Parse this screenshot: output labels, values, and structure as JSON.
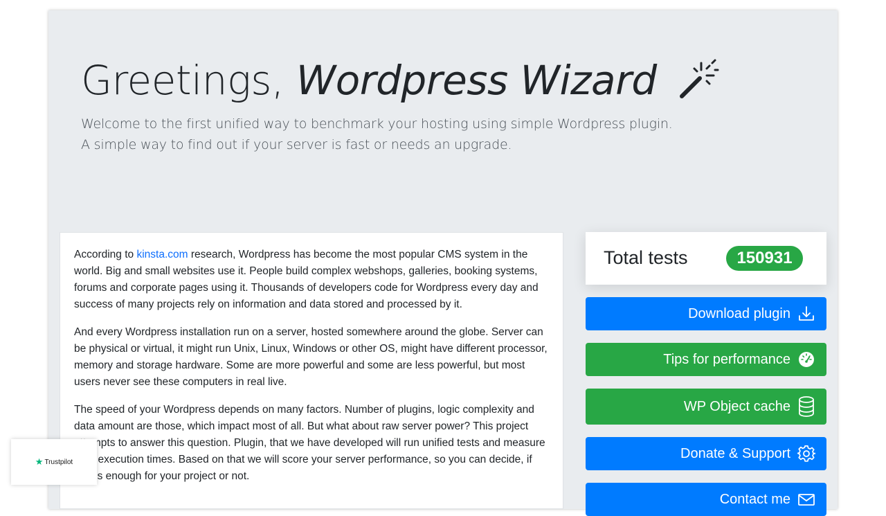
{
  "hero": {
    "title_plain": "Greetings, ",
    "title_italic": "Wordpress Wizard",
    "icon": "magic-wand-icon",
    "lead_line1": "Welcome to the first unified way to benchmark your hosting using simple Wordpress plugin.",
    "lead_line2": "A simple way to find out if your server is fast or needs an upgrade."
  },
  "content": {
    "p1_before_link": "According to ",
    "p1_link": "kinsta.com",
    "p1_after_link": " research, Wordpress has become the most popular CMS system in the world. Big and small websites use it. People build complex webshops, galleries, booking systems, forums and corporate pages using it. Thousands of developers code for Wordpress every day and success of many projects rely on information and data stored and processed by it.",
    "p2": "And every Wordpress installation run on a server, hosted somewhere around the globe. Server can be physical or virtual, it might run Unix, Linux, Windows or other OS, might have different processor, memory and storage hardware. Some are more powerful and some are less powerful, but most users never see these computers in real live.",
    "p3": "The speed of your Wordpress depends on many factors. Number of plugins, logic complexity and data amount are those, which impact most of all. But what about raw server power? This project attempts to answer this question. Plugin, that we have developed will run unified tests and measure their execution times. Based on that we will score your server performance, so you can decide, if that is enough for your project or not."
  },
  "stats": {
    "label": "Total tests",
    "count": "150931"
  },
  "sidebar_buttons": [
    {
      "label": "Download plugin",
      "icon": "download-icon",
      "color": "#007bff"
    },
    {
      "label": "Tips for performance",
      "icon": "speedometer-icon",
      "color": "#28a745"
    },
    {
      "label": "WP Object cache",
      "icon": "database-icon",
      "color": "#28a745"
    },
    {
      "label": "Donate & Support",
      "icon": "gear-icon",
      "color": "#007bff"
    },
    {
      "label": "Contact me",
      "icon": "envelope-icon",
      "color": "#007bff"
    }
  ],
  "trustpilot": {
    "label": "Trustpilot",
    "icon": "star-icon"
  },
  "colors": {
    "primary": "#007bff",
    "success": "#28a745",
    "jumbotron_bg": "#e9ecef"
  }
}
